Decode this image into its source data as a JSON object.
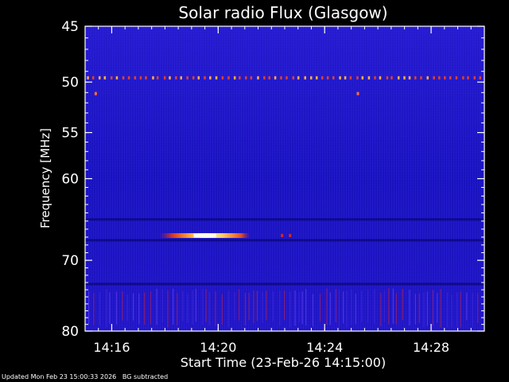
{
  "footer": {
    "updated": "Updated Mon Feb 23 15:00:33 2026",
    "note": "BG subtracted"
  },
  "colors": {
    "background": "#000000",
    "spectrogram_base": "#1a14c8",
    "burst_low": "#c8281e",
    "burst_high": "#ffffc8",
    "text": "#ffffff"
  },
  "chart_data": {
    "type": "heatmap",
    "title": "Solar radio Flux (Glasgow)",
    "xlabel": "Start Time (23-Feb-26 14:15:00)",
    "ylabel": "Frequency [MHz]",
    "x_unit": "minutes after 14:15:00",
    "xlim": [
      0,
      15
    ],
    "y_scale": "log",
    "ylim_top_to_bottom": [
      45,
      80
    ],
    "xticks": [
      {
        "value": 1,
        "label": "14:16"
      },
      {
        "value": 5,
        "label": "14:20"
      },
      {
        "value": 9,
        "label": "14:24"
      },
      {
        "value": 13,
        "label": "14:28"
      }
    ],
    "yticks": [
      {
        "value": 45,
        "label": "45"
      },
      {
        "value": 50,
        "label": "50"
      },
      {
        "value": 55,
        "label": "55"
      },
      {
        "value": 60,
        "label": "60"
      },
      {
        "value": 70,
        "label": "70"
      },
      {
        "value": 80,
        "label": "80"
      }
    ],
    "features": [
      {
        "kind": "interference-line",
        "freq_mhz": 49.6,
        "t_start": 0,
        "t_end": 15,
        "intensity": "medium"
      },
      {
        "kind": "spot",
        "freq_mhz": 51.1,
        "t": 0.4,
        "intensity": "medium"
      },
      {
        "kind": "spot",
        "freq_mhz": 51.1,
        "t": 10.25,
        "intensity": "medium"
      },
      {
        "kind": "burst",
        "freq_mhz": 66.8,
        "t_start": 2.8,
        "t_end": 6.2,
        "peak_t": 4.5,
        "intensity": "high"
      },
      {
        "kind": "spot",
        "freq_mhz": 66.8,
        "t": 7.4,
        "intensity": "low"
      },
      {
        "kind": "spot",
        "freq_mhz": 66.8,
        "t": 7.7,
        "intensity": "low"
      },
      {
        "kind": "dark-band",
        "freq_mhz": 64.8,
        "t_start": 0,
        "t_end": 15,
        "intensity": "low"
      },
      {
        "kind": "dark-band",
        "freq_mhz": 67.4,
        "t_start": 0,
        "t_end": 15,
        "intensity": "low"
      },
      {
        "kind": "dark-band",
        "freq_mhz": 73.2,
        "t_start": 0,
        "t_end": 15,
        "intensity": "low"
      },
      {
        "kind": "vertical-streaks",
        "freq_from": 73.8,
        "freq_to": 79.5,
        "t_start": 0,
        "t_end": 15,
        "intensity": "low"
      }
    ]
  }
}
